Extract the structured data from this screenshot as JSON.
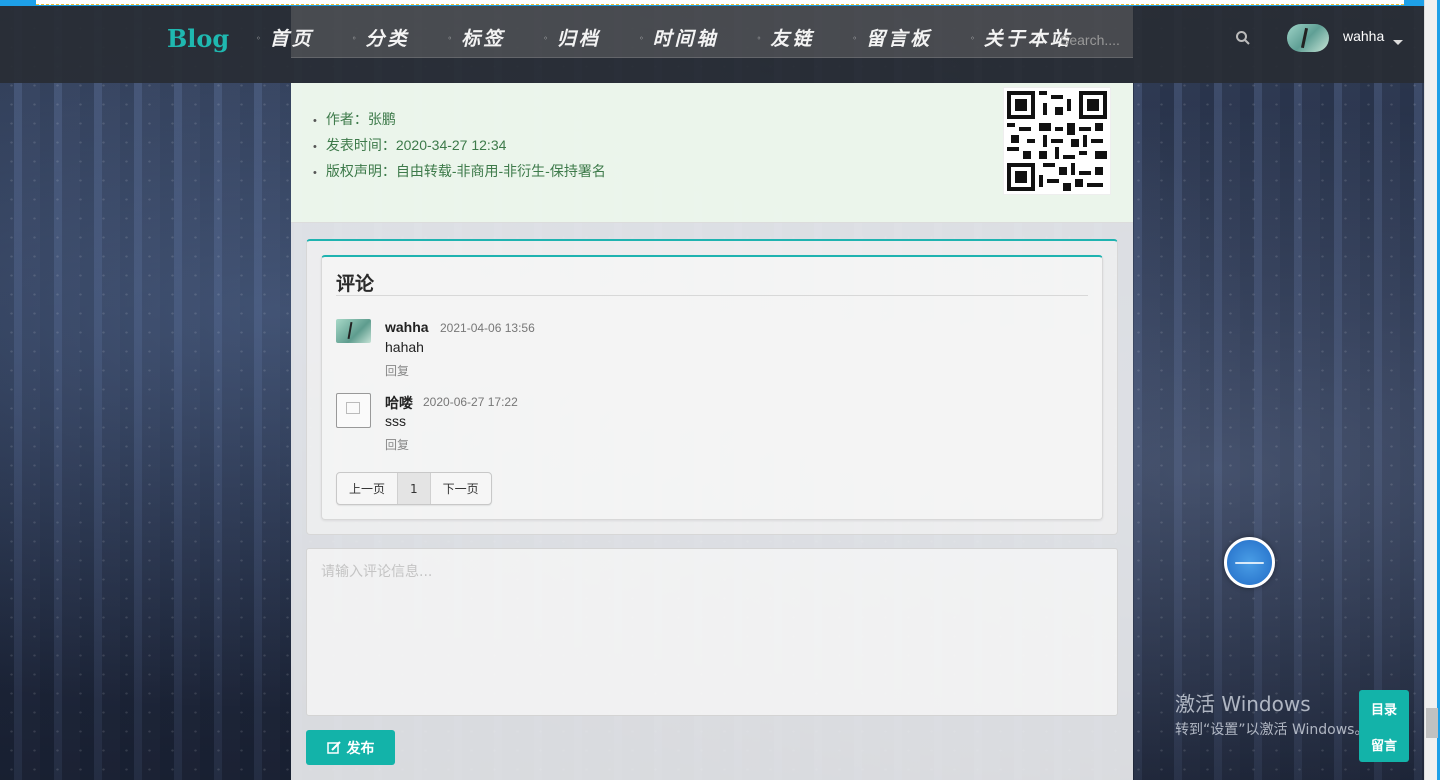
{
  "navbar": {
    "brand": "Blog",
    "items": [
      {
        "label": "首页",
        "icon": "home-icon"
      },
      {
        "label": "分类",
        "icon": "category-icon"
      },
      {
        "label": "标签",
        "icon": "tag-icon"
      },
      {
        "label": "归档",
        "icon": "archive-icon"
      },
      {
        "label": "时间轴",
        "icon": "clock-icon"
      },
      {
        "label": "友链",
        "icon": "link-icon"
      },
      {
        "label": "留言板",
        "icon": "message-icon"
      },
      {
        "label": "关于本站",
        "icon": "info-icon"
      }
    ],
    "search_placeholder": "Search....",
    "user_name": "wahha"
  },
  "post_info": {
    "author": "作者：张鹏",
    "published": "发表时间：2020-34-27 12:34",
    "license": "版权声明：自由转载-非商用-非衍生-保持署名"
  },
  "comments": {
    "title": "评论",
    "items": [
      {
        "author": "wahha",
        "time": "2021-04-06 13:56",
        "text": "hahah",
        "reply": "回复"
      },
      {
        "author": "哈喽",
        "time": "2020-06-27 17:22",
        "text": "sss",
        "reply": "回复"
      }
    ],
    "pager": {
      "prev": "上一页",
      "current": "1",
      "next": "下一页"
    }
  },
  "reply_form": {
    "placeholder": "请输入评论信息...",
    "submit_label": "发布"
  },
  "side_buttons": {
    "toc": "目录",
    "message": "留言"
  },
  "watermark": {
    "line1": "激活 Windows",
    "line2": "转到“设置”以激活 Windows。"
  },
  "colors": {
    "accent": "#13b3a9",
    "brand": "#1fb8b0",
    "info_text": "#3d7a4a"
  }
}
